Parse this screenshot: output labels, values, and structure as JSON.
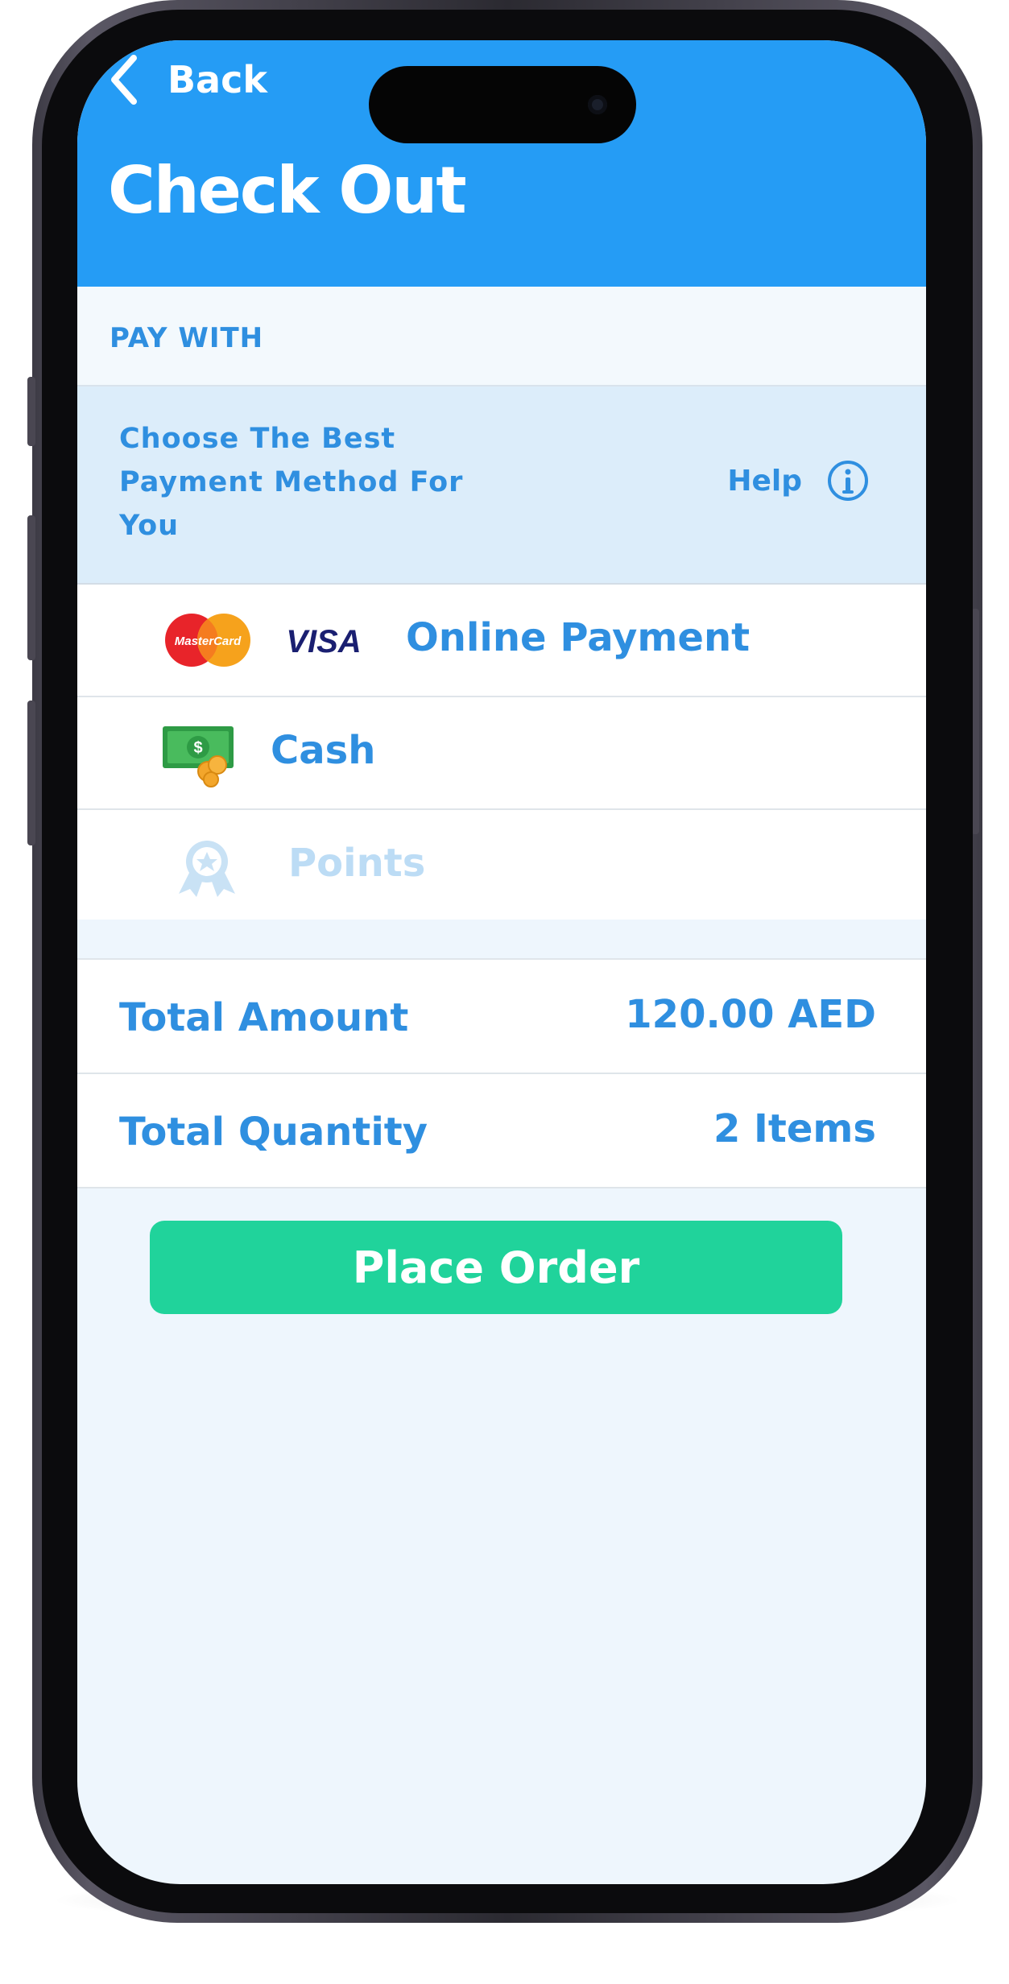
{
  "header": {
    "back_label": "Back",
    "title": "Check Out"
  },
  "pay_with": {
    "section_label": "PAY WITH",
    "hint_line1": "Choose The Best",
    "hint_line2": "Payment Method For",
    "hint_line3": "You",
    "help_label": "Help"
  },
  "methods": [
    {
      "label": "Online Payment",
      "icons": [
        "mastercard-icon",
        "visa-icon"
      ],
      "enabled": true
    },
    {
      "label": "Cash",
      "icons": [
        "cash-icon"
      ],
      "enabled": true
    },
    {
      "label": "Points",
      "icons": [
        "award-icon"
      ],
      "enabled": false
    }
  ],
  "visa_text": "VISA",
  "mastercard_text": "MasterCard",
  "summary": {
    "total_amount_label": "Total Amount",
    "total_amount_value": "120.00 AED",
    "total_quantity_label": "Total Quantity",
    "total_quantity_value": "2 Items"
  },
  "actions": {
    "place_order_label": "Place Order"
  },
  "colors": {
    "header_blue": "#259cf5",
    "text_blue": "#2f8fe0",
    "hint_bg": "#dcedfa",
    "place_order_green": "#20d39b",
    "disabled_text": "#bcdcf5"
  }
}
